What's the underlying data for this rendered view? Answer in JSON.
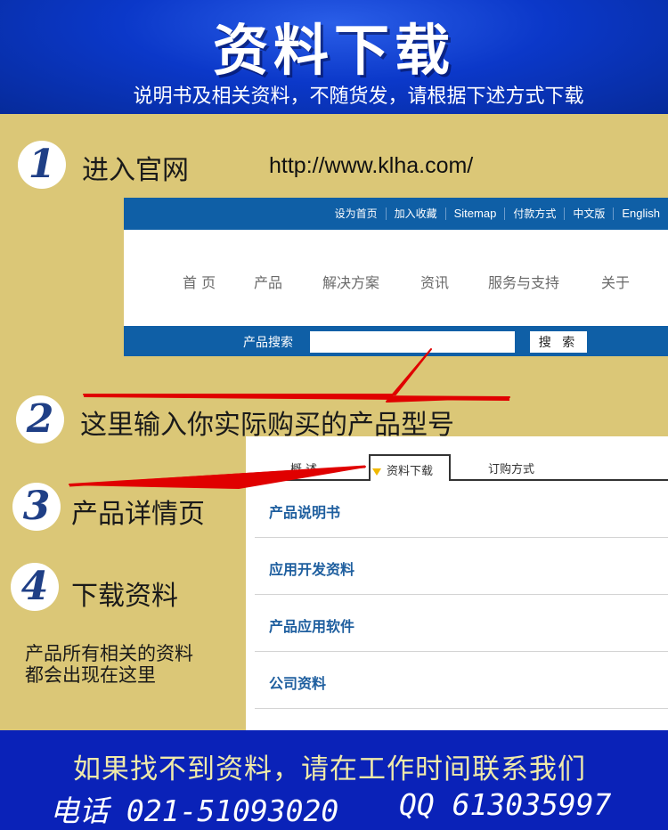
{
  "header": {
    "title": "资料下载",
    "subtitle": "说明书及相关资料，不随货发，请根据下述方式下载"
  },
  "steps": [
    {
      "num": "1",
      "label": "进入官网"
    },
    {
      "num": "2",
      "label": "这里输入你实际购买的产品型号"
    },
    {
      "num": "3",
      "label": "产品详情页"
    },
    {
      "num": "4",
      "label": "下载资料"
    }
  ],
  "url": "http://www.klha.com/",
  "site": {
    "topbar_links": [
      "设为首页",
      "加入收藏",
      "Sitemap",
      "付款方式",
      "中文版",
      "English"
    ],
    "nav": [
      "首 页",
      "产品",
      "解决方案",
      "资讯",
      "服务与支持",
      "关于"
    ],
    "search_label": "产品搜索",
    "search_button": "搜 索"
  },
  "detail": {
    "tabs": [
      "概 述",
      "资料下载",
      "订购方式"
    ],
    "items": [
      "产品说明书",
      "应用开发资料",
      "产品应用软件",
      "公司资料"
    ]
  },
  "note": [
    "产品所有相关的资料",
    "都会出现在这里"
  ],
  "footer": {
    "line1": "如果找不到资料，请在工作时间联系我们",
    "phone": "电话 021-51093020",
    "qq": "QQ 613035997"
  },
  "colors": {
    "header_blue": "#0b38c9",
    "panel_tan": "#dbc777",
    "site_blue": "#0f5fa6",
    "callout_red": "#e00000",
    "footer_blue": "#0a22b8",
    "footer_text": "#efe9a9"
  }
}
